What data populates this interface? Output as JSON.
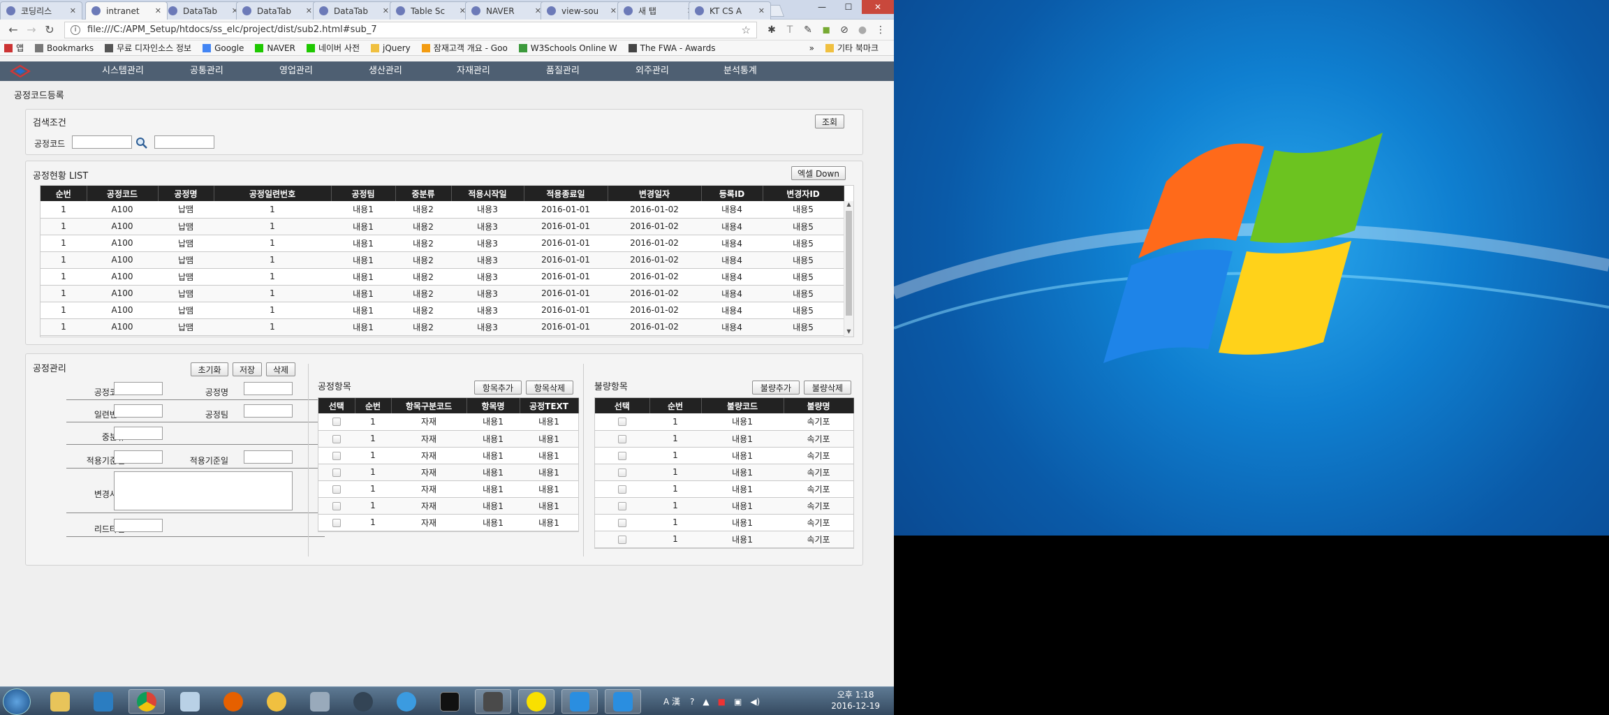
{
  "browser": {
    "tabs": [
      {
        "label": "코딩리스",
        "x": 0
      },
      {
        "label": "intranet",
        "x": 0
      },
      {
        "label": "DataTab",
        "x": 0
      },
      {
        "label": "DataTab",
        "x": 0
      },
      {
        "label": "DataTab",
        "x": 0
      },
      {
        "label": "Table Sc",
        "x": 0
      },
      {
        "label": "NAVER",
        "x": 0
      },
      {
        "label": "view-sou",
        "x": 0
      },
      {
        "label": "새 탭",
        "x": 0
      },
      {
        "label": "KT CS A",
        "x": 0
      }
    ],
    "url": "file:///C:/APM_Setup/htdocs/ss_elc/project/dist/sub2.html#sub_7",
    "bookmarks": [
      "앱",
      "Bookmarks",
      "무료 디자인소스 정보",
      "Google",
      "NAVER",
      "네이버 사전",
      "jQuery",
      "잠재고객 개요 - Goo",
      "W3Schools Online W",
      "The FWA - Awards"
    ],
    "other_bookmarks": "기타 북마크"
  },
  "nav": {
    "menu": [
      "시스템관리",
      "공통관리",
      "영업관리",
      "생산관리",
      "자재관리",
      "품질관리",
      "외주관리",
      "분석통계"
    ]
  },
  "page_title": "공정코드등록",
  "search": {
    "title": "검색조건",
    "code_label": "공정코드",
    "search_button": "조회"
  },
  "list": {
    "title": "공정현황 LIST",
    "excel_button": "엑셀 Down",
    "columns": [
      "순번",
      "공정코드",
      "공정명",
      "공정일련번호",
      "공정팀",
      "중분류",
      "적용시작일",
      "적용종료일",
      "변경일자",
      "등록ID",
      "변경자ID"
    ],
    "rows": [
      [
        "1",
        "A100",
        "납땜",
        "1",
        "내용1",
        "내용2",
        "내용3",
        "2016-01-01",
        "2016-01-02",
        "내용4",
        "내용5"
      ],
      [
        "1",
        "A100",
        "납땜",
        "1",
        "내용1",
        "내용2",
        "내용3",
        "2016-01-01",
        "2016-01-02",
        "내용4",
        "내용5"
      ],
      [
        "1",
        "A100",
        "납땜",
        "1",
        "내용1",
        "내용2",
        "내용3",
        "2016-01-01",
        "2016-01-02",
        "내용4",
        "내용5"
      ],
      [
        "1",
        "A100",
        "납땜",
        "1",
        "내용1",
        "내용2",
        "내용3",
        "2016-01-01",
        "2016-01-02",
        "내용4",
        "내용5"
      ],
      [
        "1",
        "A100",
        "납땜",
        "1",
        "내용1",
        "내용2",
        "내용3",
        "2016-01-01",
        "2016-01-02",
        "내용4",
        "내용5"
      ],
      [
        "1",
        "A100",
        "납땜",
        "1",
        "내용1",
        "내용2",
        "내용3",
        "2016-01-01",
        "2016-01-02",
        "내용4",
        "내용5"
      ],
      [
        "1",
        "A100",
        "납땜",
        "1",
        "내용1",
        "내용2",
        "내용3",
        "2016-01-01",
        "2016-01-02",
        "내용4",
        "내용5"
      ],
      [
        "1",
        "A100",
        "납땜",
        "1",
        "내용1",
        "내용2",
        "내용3",
        "2016-01-01",
        "2016-01-02",
        "내용4",
        "내용5"
      ]
    ]
  },
  "manage": {
    "title": "공정관리",
    "buttons": [
      "초기화",
      "저장",
      "삭제"
    ],
    "labels": {
      "code": "공정코드",
      "name": "공정명",
      "serial": "일련번호",
      "team": "공정팀",
      "mid": "중분류",
      "start": "적용기준일",
      "end": "적용기준일",
      "reason": "변경사유",
      "lead": "리드타임"
    }
  },
  "process_items": {
    "title": "공정항목",
    "add_button": "항목추가",
    "del_button": "항목삭제",
    "columns": [
      "선택",
      "순번",
      "항목구분코드",
      "항목명",
      "공정TEXT"
    ],
    "rows": [
      [
        "1",
        "자재",
        "내용1",
        "내용1"
      ],
      [
        "1",
        "자재",
        "내용1",
        "내용1"
      ],
      [
        "1",
        "자재",
        "내용1",
        "내용1"
      ],
      [
        "1",
        "자재",
        "내용1",
        "내용1"
      ],
      [
        "1",
        "자재",
        "내용1",
        "내용1"
      ],
      [
        "1",
        "자재",
        "내용1",
        "내용1"
      ],
      [
        "1",
        "자재",
        "내용1",
        "내용1"
      ]
    ]
  },
  "defect_items": {
    "title": "불량항목",
    "add_button": "불량추가",
    "del_button": "불량삭제",
    "columns": [
      "선택",
      "순번",
      "불량코드",
      "불량명"
    ],
    "rows": [
      [
        "1",
        "내용1",
        "속기포"
      ],
      [
        "1",
        "내용1",
        "속기포"
      ],
      [
        "1",
        "내용1",
        "속기포"
      ],
      [
        "1",
        "내용1",
        "속기포"
      ],
      [
        "1",
        "내용1",
        "속기포"
      ],
      [
        "1",
        "내용1",
        "속기포"
      ],
      [
        "1",
        "내용1",
        "속기포"
      ],
      [
        "1",
        "내용1",
        "속기포"
      ]
    ]
  },
  "taskbar": {
    "time": "오후 1:18",
    "date": "2016-12-19",
    "ime": "A 漢"
  }
}
